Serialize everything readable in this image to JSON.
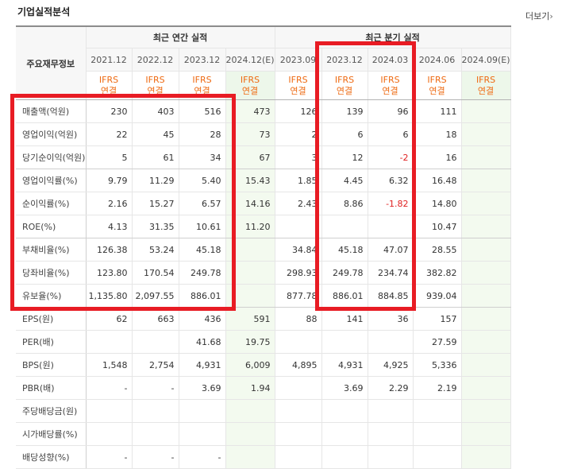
{
  "header": {
    "title": "기업실적분석",
    "more_label": "더보기",
    "more_arrow": "›"
  },
  "table": {
    "corner_label": "주요재무정보",
    "groups": {
      "annual": "최근 연간 실적",
      "quarterly": "최근 분기 실적"
    },
    "annual_periods": [
      "2021.12",
      "2022.12",
      "2023.12",
      "2024.12(E)"
    ],
    "quarter_periods": [
      "2023.09",
      "2023.12",
      "2024.03",
      "2024.06",
      "2024.09(E)"
    ],
    "basis_line1": "IFRS",
    "basis_line2": "연결",
    "rows": [
      {
        "label": "매출액(억원)",
        "annual": [
          "230",
          "403",
          "516",
          "473"
        ],
        "quarter": [
          "126",
          "139",
          "96",
          "111",
          ""
        ]
      },
      {
        "label": "영업이익(억원)",
        "annual": [
          "22",
          "45",
          "28",
          "73"
        ],
        "quarter": [
          "2",
          "6",
          "6",
          "18",
          ""
        ]
      },
      {
        "label": "당기순이익(억원)",
        "annual": [
          "5",
          "61",
          "34",
          "67"
        ],
        "quarter": [
          "3",
          "12",
          "-2",
          "16",
          ""
        ]
      },
      {
        "label": "영업이익률(%)",
        "annual": [
          "9.79",
          "11.29",
          "5.40",
          "15.43"
        ],
        "quarter": [
          "1.85",
          "4.45",
          "6.32",
          "16.48",
          ""
        ]
      },
      {
        "label": "순이익률(%)",
        "annual": [
          "2.16",
          "15.27",
          "6.57",
          "14.16"
        ],
        "quarter": [
          "2.43",
          "8.86",
          "-1.82",
          "14.80",
          ""
        ]
      },
      {
        "label": "ROE(%)",
        "annual": [
          "4.13",
          "31.35",
          "10.61",
          "11.20"
        ],
        "quarter": [
          "",
          "",
          "",
          "10.47",
          ""
        ]
      },
      {
        "label": "부채비율(%)",
        "annual": [
          "126.38",
          "53.24",
          "45.18",
          ""
        ],
        "quarter": [
          "34.84",
          "45.18",
          "47.07",
          "28.55",
          ""
        ]
      },
      {
        "label": "당좌비율(%)",
        "annual": [
          "123.80",
          "170.54",
          "249.78",
          ""
        ],
        "quarter": [
          "298.93",
          "249.78",
          "234.74",
          "382.82",
          ""
        ]
      },
      {
        "label": "유보율(%)",
        "annual": [
          "1,135.80",
          "2,097.55",
          "886.01",
          ""
        ],
        "quarter": [
          "877.78",
          "886.01",
          "884.85",
          "939.04",
          ""
        ]
      },
      {
        "label": "EPS(원)",
        "annual": [
          "62",
          "663",
          "436",
          "591"
        ],
        "quarter": [
          "88",
          "141",
          "36",
          "157",
          ""
        ]
      },
      {
        "label": "PER(배)",
        "annual": [
          "",
          "",
          "41.68",
          "19.75"
        ],
        "quarter": [
          "",
          "",
          "",
          "27.59",
          ""
        ]
      },
      {
        "label": "BPS(원)",
        "annual": [
          "1,548",
          "2,754",
          "4,931",
          "6,009"
        ],
        "quarter": [
          "4,895",
          "4,931",
          "4,925",
          "5,336",
          ""
        ]
      },
      {
        "label": "PBR(배)",
        "annual": [
          "-",
          "-",
          "3.69",
          "1.94"
        ],
        "quarter": [
          "",
          "3.69",
          "2.29",
          "2.19",
          ""
        ]
      },
      {
        "label": "주당배당금(원)",
        "annual": [
          "",
          "",
          "",
          ""
        ],
        "quarter": [
          "",
          "",
          "",
          "",
          ""
        ]
      },
      {
        "label": "시가배당률(%)",
        "annual": [
          "",
          "",
          "",
          ""
        ],
        "quarter": [
          "",
          "",
          "",
          "",
          ""
        ]
      },
      {
        "label": "배당성향(%)",
        "annual": [
          "-",
          "-",
          "-",
          ""
        ],
        "quarter": [
          "",
          "",
          "",
          "",
          ""
        ]
      }
    ]
  },
  "colors": {
    "highlight": "#e81c24",
    "basis": "#ee6a12",
    "negative": "#e02020",
    "estimate_bg": "#edf7ea"
  }
}
